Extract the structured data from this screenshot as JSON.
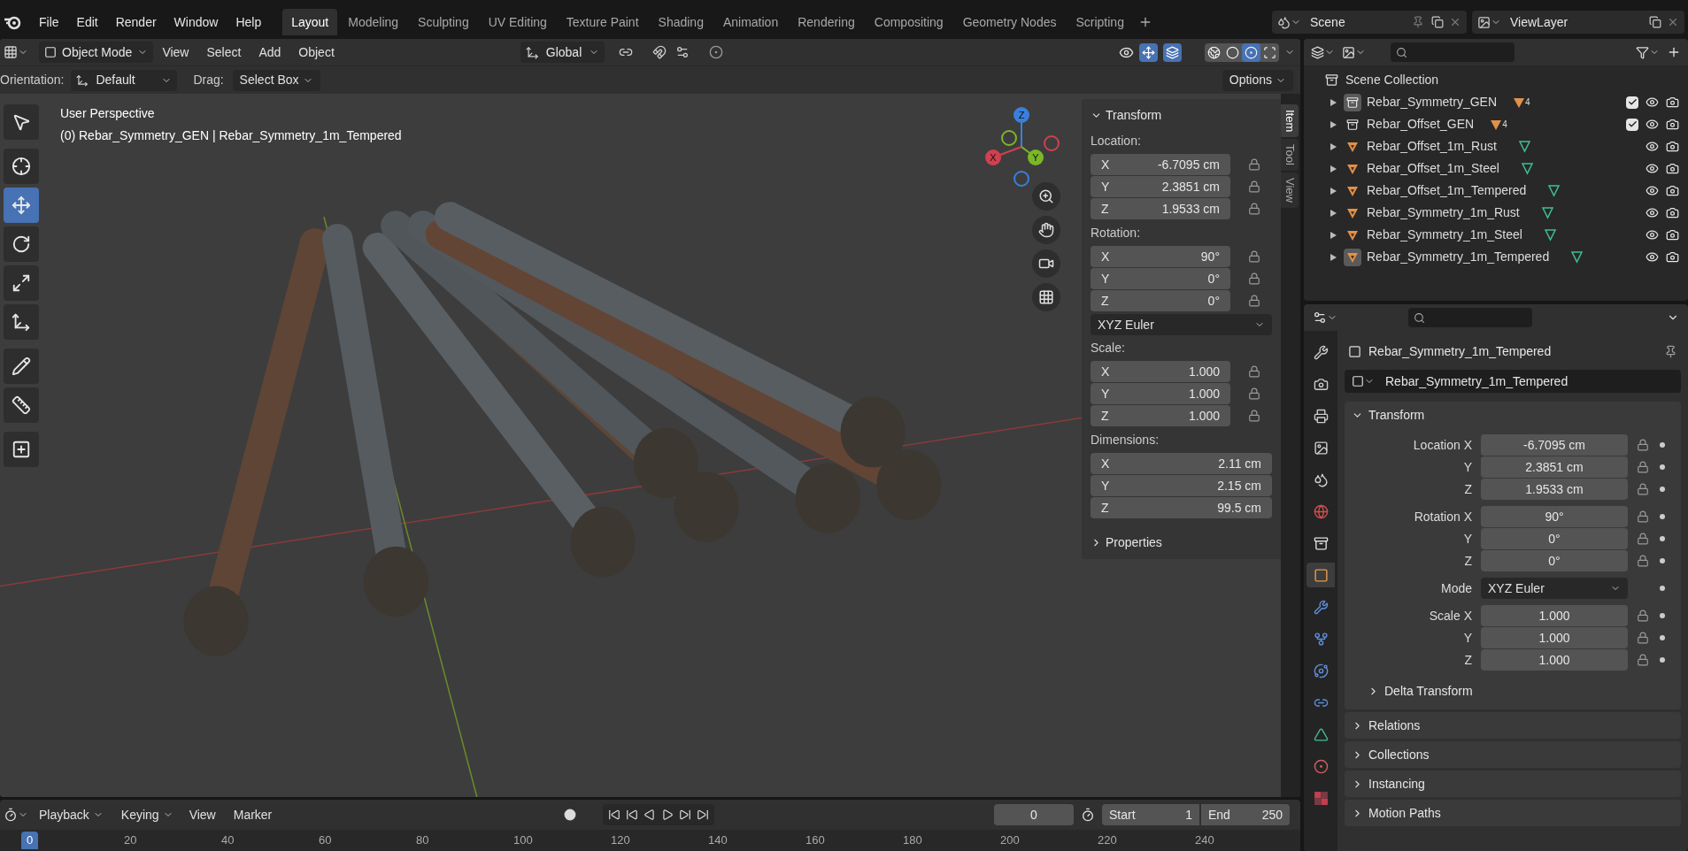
{
  "menu": [
    "File",
    "Edit",
    "Render",
    "Window",
    "Help"
  ],
  "workspaces": [
    {
      "label": "Layout",
      "selected": true
    },
    {
      "label": "Modeling",
      "selected": false
    },
    {
      "label": "Sculpting",
      "selected": false
    },
    {
      "label": "UV Editing",
      "selected": false
    },
    {
      "label": "Texture Paint",
      "selected": false
    },
    {
      "label": "Shading",
      "selected": false
    },
    {
      "label": "Animation",
      "selected": false
    },
    {
      "label": "Rendering",
      "selected": false
    },
    {
      "label": "Compositing",
      "selected": false
    },
    {
      "label": "Geometry Nodes",
      "selected": false
    },
    {
      "label": "Scripting",
      "selected": false
    }
  ],
  "scene": "Scene",
  "view_layer": "ViewLayer",
  "viewport": {
    "mode": "Object Mode",
    "menus": [
      "View",
      "Select",
      "Add",
      "Object"
    ],
    "orientation": "Global",
    "gizmos_on": true,
    "overlays_on": true,
    "shading_modes": [
      {
        "kind": "wireframe",
        "selected": false
      },
      {
        "kind": "solid",
        "selected": false
      },
      {
        "kind": "material",
        "selected": true
      },
      {
        "kind": "rendered",
        "selected": false
      }
    ],
    "tool_settings": {
      "orientation_label": "Orientation:",
      "orientation": "Default",
      "drag_label": "Drag:",
      "drag": "Select Box",
      "options": "Options"
    },
    "view_name": "User Perspective",
    "object_info": "(0) Rebar_Symmetry_GEN | Rebar_Symmetry_1m_Tempered",
    "gizmo_axes": [
      "X",
      "Y",
      "Z"
    ],
    "tools": [
      {
        "kind": "select",
        "selected": false
      },
      {
        "kind": "cursor",
        "selected": false
      },
      {
        "kind": "move",
        "selected": true
      },
      {
        "kind": "rotate",
        "selected": false
      },
      {
        "kind": "scale",
        "selected": false
      },
      {
        "kind": "transform",
        "selected": false
      },
      {
        "kind": "annotate",
        "selected": false
      },
      {
        "kind": "measure",
        "selected": false
      },
      {
        "kind": "add",
        "selected": false
      }
    ],
    "sidebar": {
      "tabs": [
        {
          "label": "Item",
          "selected": true
        },
        {
          "label": "Tool",
          "selected": false
        },
        {
          "label": "View",
          "selected": false
        }
      ],
      "panel_title": "Transform",
      "groups": [
        {
          "label": "Location:",
          "locked": false,
          "rows": [
            {
              "axis": "X",
              "value": "-6.7095 cm"
            },
            {
              "axis": "Y",
              "value": "2.3851 cm"
            },
            {
              "axis": "Z",
              "value": "1.9533 cm"
            }
          ]
        },
        {
          "label": "Rotation:",
          "locked": false,
          "rows": [
            {
              "axis": "X",
              "value": "90°"
            },
            {
              "axis": "Y",
              "value": "0°"
            },
            {
              "axis": "Z",
              "value": "0°"
            }
          ],
          "mode": "XYZ Euler"
        },
        {
          "label": "Scale:",
          "locked": false,
          "rows": [
            {
              "axis": "X",
              "value": "1.000"
            },
            {
              "axis": "Y",
              "value": "1.000"
            },
            {
              "axis": "Z",
              "value": "1.000"
            }
          ]
        },
        {
          "label": "Dimensions:",
          "rows": [
            {
              "axis": "X",
              "value": "2.11 cm"
            },
            {
              "axis": "Y",
              "value": "2.15 cm"
            },
            {
              "axis": "Z",
              "value": "99.5 cm"
            }
          ]
        }
      ],
      "collapsed_panel": "Properties"
    }
  },
  "outliner": {
    "root": "Scene Collection",
    "items": [
      {
        "name": "Rebar_Symmetry_GEN",
        "kind": "collection",
        "count": "4",
        "checked": true,
        "selected": true
      },
      {
        "name": "Rebar_Offset_GEN",
        "kind": "collection",
        "count": "4",
        "checked": true,
        "selected": false
      },
      {
        "name": "Rebar_Offset_1m_Rust",
        "kind": "mesh",
        "selected": false
      },
      {
        "name": "Rebar_Offset_1m_Steel",
        "kind": "mesh",
        "selected": false
      },
      {
        "name": "Rebar_Offset_1m_Tempered",
        "kind": "mesh",
        "selected": false
      },
      {
        "name": "Rebar_Symmetry_1m_Rust",
        "kind": "mesh",
        "selected": false
      },
      {
        "name": "Rebar_Symmetry_1m_Steel",
        "kind": "mesh",
        "selected": false
      },
      {
        "name": "Rebar_Symmetry_1m_Tempered",
        "kind": "mesh",
        "selected": true
      }
    ]
  },
  "properties": {
    "tabs": [
      {
        "kind": "tool",
        "selected": false
      },
      {
        "kind": "render",
        "selected": false
      },
      {
        "kind": "output",
        "selected": false
      },
      {
        "kind": "view_layer",
        "selected": false
      },
      {
        "kind": "scene",
        "selected": false
      },
      {
        "kind": "world",
        "selected": false
      },
      {
        "kind": "collection",
        "selected": false
      },
      {
        "kind": "object",
        "selected": true
      },
      {
        "kind": "modifiers",
        "selected": false
      },
      {
        "kind": "particles",
        "selected": false
      },
      {
        "kind": "physics",
        "selected": false
      },
      {
        "kind": "constraints",
        "selected": false
      },
      {
        "kind": "data",
        "selected": false
      },
      {
        "kind": "material",
        "selected": false
      },
      {
        "kind": "texture",
        "selected": false
      }
    ],
    "object_name": "Rebar_Symmetry_1m_Tempered",
    "datablock": "Rebar_Symmetry_1m_Tempered",
    "panel": "Transform",
    "groups": [
      [
        {
          "label": "Location X",
          "value": "-6.7095 cm",
          "kind": "number"
        },
        {
          "label": "Y",
          "value": "2.3851 cm",
          "kind": "number"
        },
        {
          "label": "Z",
          "value": "1.9533 cm",
          "kind": "number"
        }
      ],
      [
        {
          "label": "Rotation X",
          "value": "90°",
          "kind": "number"
        },
        {
          "label": "Y",
          "value": "0°",
          "kind": "number"
        },
        {
          "label": "Z",
          "value": "0°",
          "kind": "number"
        }
      ],
      [
        {
          "label": "Mode",
          "value": "XYZ Euler",
          "kind": "dropdown"
        }
      ],
      [
        {
          "label": "Scale X",
          "value": "1.000",
          "kind": "number"
        },
        {
          "label": "Y",
          "value": "1.000",
          "kind": "number"
        },
        {
          "label": "Z",
          "value": "1.000",
          "kind": "number"
        }
      ]
    ],
    "subpanel": "Delta Transform",
    "collapsed_panels": [
      "Relations",
      "Collections",
      "Instancing",
      "Motion Paths"
    ]
  },
  "timeline": {
    "menus": [
      "Playback",
      "Keying",
      "View",
      "Marker"
    ],
    "current_frame": "0",
    "start_label": "Start",
    "start": "1",
    "end_label": "End",
    "end": "250",
    "ruler": [
      {
        "label": "0",
        "selected": true
      },
      {
        "label": "20",
        "selected": false
      },
      {
        "label": "40",
        "selected": false
      },
      {
        "label": "60",
        "selected": false
      },
      {
        "label": "80",
        "selected": false
      },
      {
        "label": "100",
        "selected": false
      },
      {
        "label": "120",
        "selected": false
      },
      {
        "label": "140",
        "selected": false
      },
      {
        "label": "160",
        "selected": false
      },
      {
        "label": "180",
        "selected": false
      },
      {
        "label": "200",
        "selected": false
      },
      {
        "label": "220",
        "selected": false
      },
      {
        "label": "240",
        "selected": false
      }
    ]
  }
}
